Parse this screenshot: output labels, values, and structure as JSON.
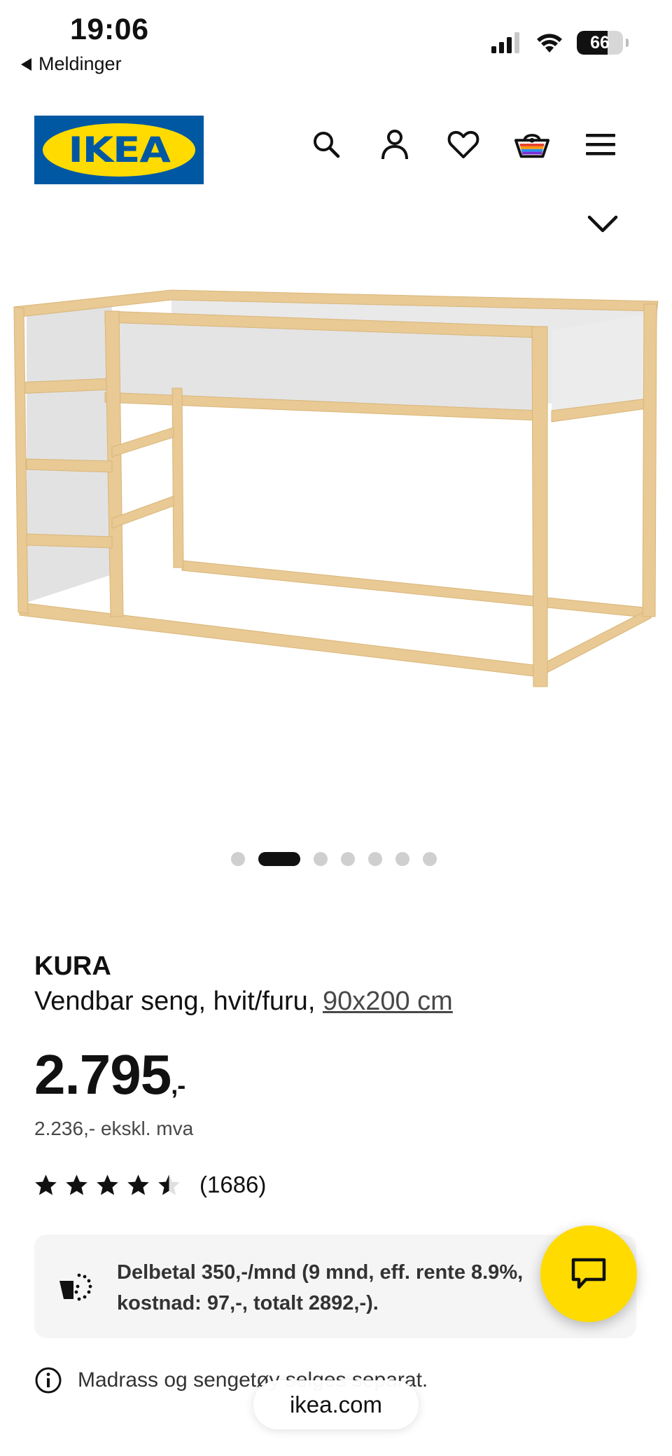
{
  "status_bar": {
    "time": "19:06",
    "back_label": "Meldinger",
    "battery_percent": "66",
    "battery_level": 0.66
  },
  "header": {
    "logo_text": "IKEA",
    "icons": [
      "search-icon",
      "user-icon",
      "heart-icon",
      "cart-icon",
      "menu-icon"
    ],
    "brand_colors": {
      "blue": "#0058a3",
      "yellow": "#ffdb00"
    }
  },
  "gallery": {
    "dot_count": 7,
    "active_index": 1
  },
  "product": {
    "name": "KURA",
    "description": "Vendbar seng, hvit/furu, ",
    "size_link": "90x200 cm",
    "price": "2.795",
    "price_suffix": ",-",
    "price_ex_vat": "2.236,- ekskl. mva",
    "rating_value": 4.5,
    "rating_count": "(1686)"
  },
  "financing": {
    "text": "Delbetal 350,-/mnd (9 mnd, eff. rente 8.9%, kostnad: 97,-, totalt 2892,-)."
  },
  "note": {
    "text": "Madrass og sengetøy selges separat."
  },
  "browser": {
    "url": "ikea.com"
  }
}
